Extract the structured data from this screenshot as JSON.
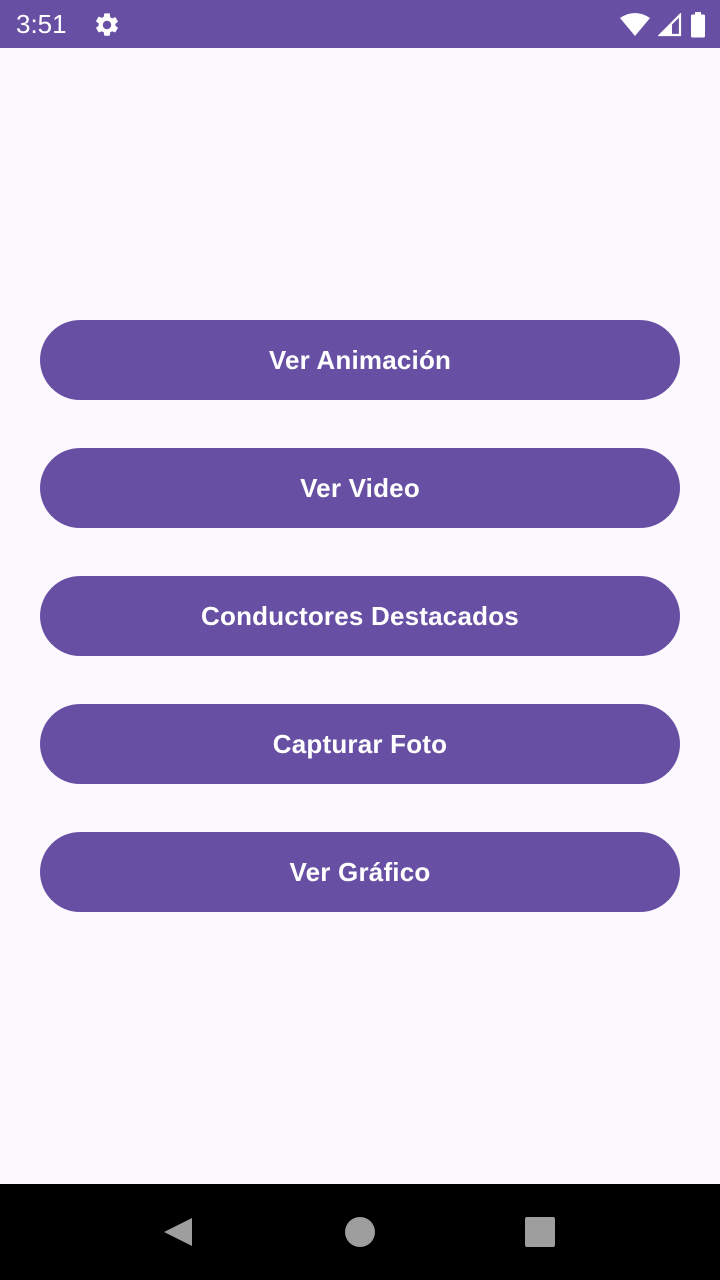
{
  "status_bar": {
    "time": "3:51",
    "background": "#6750A4",
    "icons": [
      "gear-icon",
      "wifi-icon",
      "cell-signal-icon",
      "battery-icon"
    ]
  },
  "main": {
    "buttons": [
      {
        "label": "Ver Animación"
      },
      {
        "label": "Ver Video"
      },
      {
        "label": "Conductores Destacados"
      },
      {
        "label": "Capturar Foto"
      },
      {
        "label": "Ver Gráfico"
      }
    ],
    "button_color": "#6750A4",
    "background": "#FDF7FE"
  },
  "nav_bar": {
    "icons": [
      "back-icon",
      "home-icon",
      "recents-icon"
    ]
  }
}
